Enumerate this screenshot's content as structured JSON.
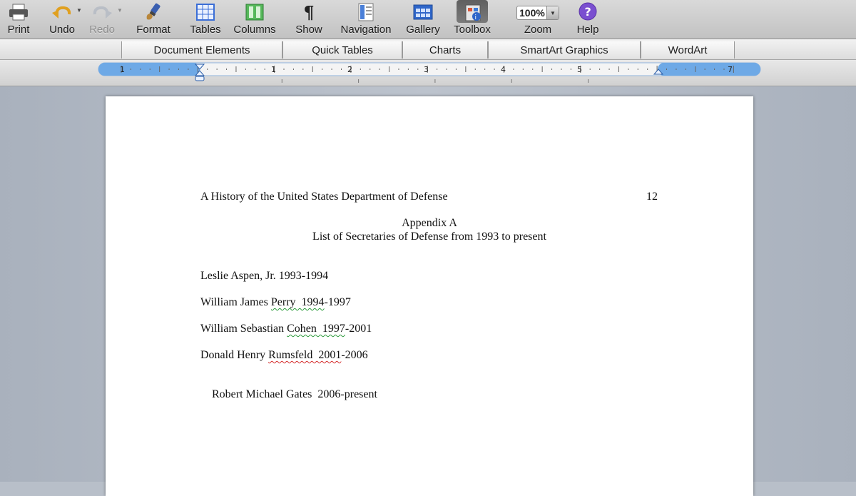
{
  "toolbar": {
    "items": [
      {
        "label": "Print",
        "icon": "printer-icon"
      },
      {
        "label": "Undo",
        "icon": "undo-icon"
      },
      {
        "label": "Redo",
        "icon": "redo-icon",
        "disabled": true
      },
      {
        "label": "Format",
        "icon": "paintbrush-icon"
      },
      {
        "label": "Tables",
        "icon": "table-icon"
      },
      {
        "label": "Columns",
        "icon": "columns-icon"
      },
      {
        "label": "Show",
        "icon": "pilcrow-icon"
      },
      {
        "label": "Navigation",
        "icon": "navigation-pane-icon"
      },
      {
        "label": "Gallery",
        "icon": "gallery-icon"
      },
      {
        "label": "Toolbox",
        "icon": "toolbox-icon",
        "pressed": true
      },
      {
        "label": "Zoom",
        "icon": "zoom-field"
      },
      {
        "label": "Help",
        "icon": "help-icon"
      }
    ],
    "zoom_value": "100%",
    "pilcrow_glyph": "¶",
    "help_glyph": "?"
  },
  "elements_gallery": {
    "tabs": [
      "Document Elements",
      "Quick Tables",
      "Charts",
      "SmartArt Graphics",
      "WordArt"
    ]
  },
  "ruler": {
    "numbers": [
      "1",
      "1",
      "2",
      "3",
      "4",
      "5",
      "7"
    ]
  },
  "document": {
    "header_title": "A History of the United States Department of Defense",
    "page_number": "12",
    "heading_line1": "Appendix A",
    "heading_line2": "List of Secretaries of Defense from 1993 to present",
    "entries": [
      {
        "name": "Leslie Aspen, Jr.",
        "flagged": "",
        "years": "1993-1994",
        "flag": "none"
      },
      {
        "name": "William James",
        "flagged": "Perry  1994",
        "years": "-1997",
        "flag": "green"
      },
      {
        "name": "William Sebastian",
        "flagged": "Cohen  1997",
        "years": "-2001",
        "flag": "green"
      },
      {
        "name": "Donald Henry",
        "flagged": "Rumsfeld  2001",
        "years": "-2006",
        "flag": "red"
      },
      {
        "name": "Robert Michael Gates",
        "flagged": "",
        "years": "2006-present",
        "flag": "none"
      }
    ]
  },
  "colors": {
    "workspace": "#b8bfc9",
    "ruler_highlight": "#6ea9e6",
    "spell_error": "#d42a2a",
    "grammar_error": "#2a9a3a",
    "help_purple": "#7a4fd0"
  }
}
